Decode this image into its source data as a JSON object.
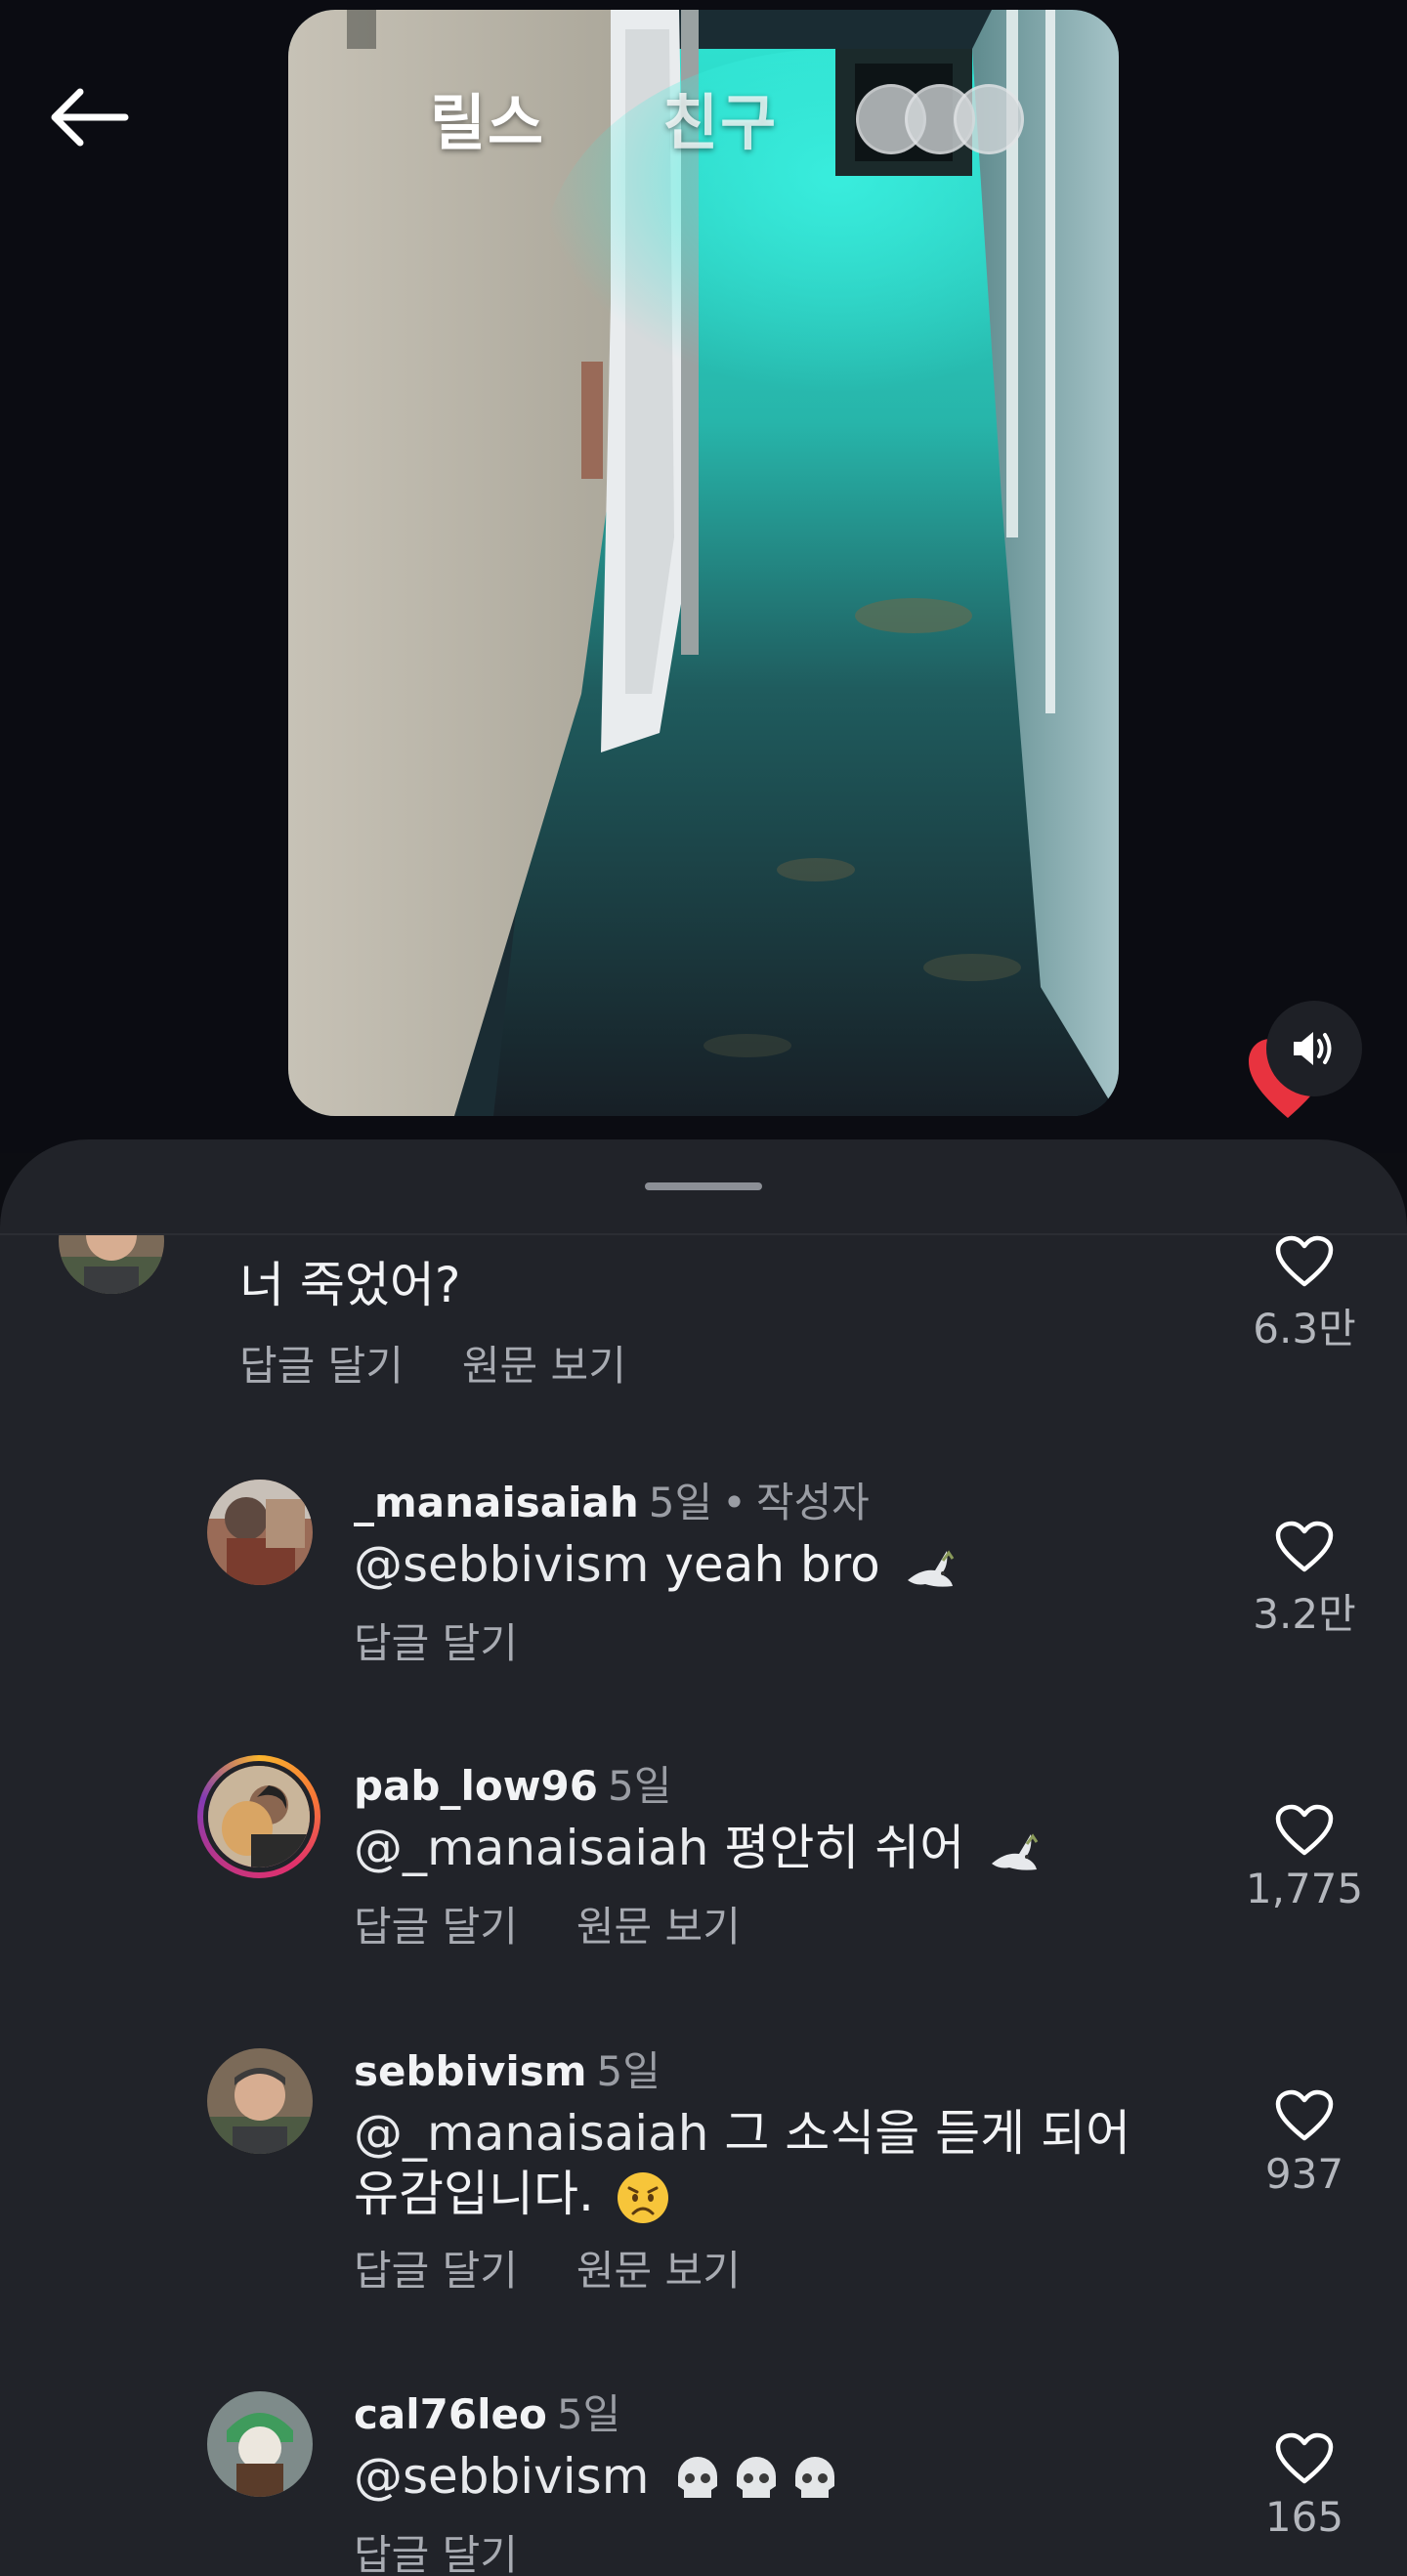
{
  "header": {
    "tabs": [
      {
        "label": "릴스"
      },
      {
        "label": "친구"
      }
    ]
  },
  "icons": {
    "back": "arrow-left-icon",
    "sound": "speaker-icon",
    "like": "heart-outline-icon",
    "reaction": "heart-filled-icon"
  },
  "colors": {
    "background": "#0c0d12",
    "sheet": "#212329",
    "reaction_red": "#e8333f",
    "muted_text": "#9a9da4"
  },
  "comments": [
    {
      "username": "",
      "time": "",
      "text": "너 죽었어?",
      "reply_label": "답글 달기",
      "original_label": "원문 보기",
      "likes": "6.3만"
    },
    {
      "username": "_manaisaiah",
      "time": "5일",
      "author_tag": "작성자",
      "mention": "@sebbivism",
      "text": "yeah bro",
      "emoji": "dove",
      "reply_label": "답글 달기",
      "likes": "3.2만"
    },
    {
      "username": "pab_low96",
      "time": "5일",
      "mention": "@_manaisaiah",
      "text": "평안히 쉬어",
      "emoji": "dove",
      "reply_label": "답글 달기",
      "original_label": "원문 보기",
      "likes": "1,775"
    },
    {
      "username": "sebbivism",
      "time": "5일",
      "mention": "@_manaisaiah",
      "text": "그 소식을 듣게 되어",
      "text_line2": "유감입니다.",
      "emoji": "worried-face",
      "reply_label": "답글 달기",
      "original_label": "원문 보기",
      "likes": "937"
    },
    {
      "username": "cal76leo",
      "time": "5일",
      "mention": "@sebbivism",
      "text": "",
      "emoji": "skull x3",
      "reply_label": "답글 달기",
      "likes": "165"
    }
  ]
}
